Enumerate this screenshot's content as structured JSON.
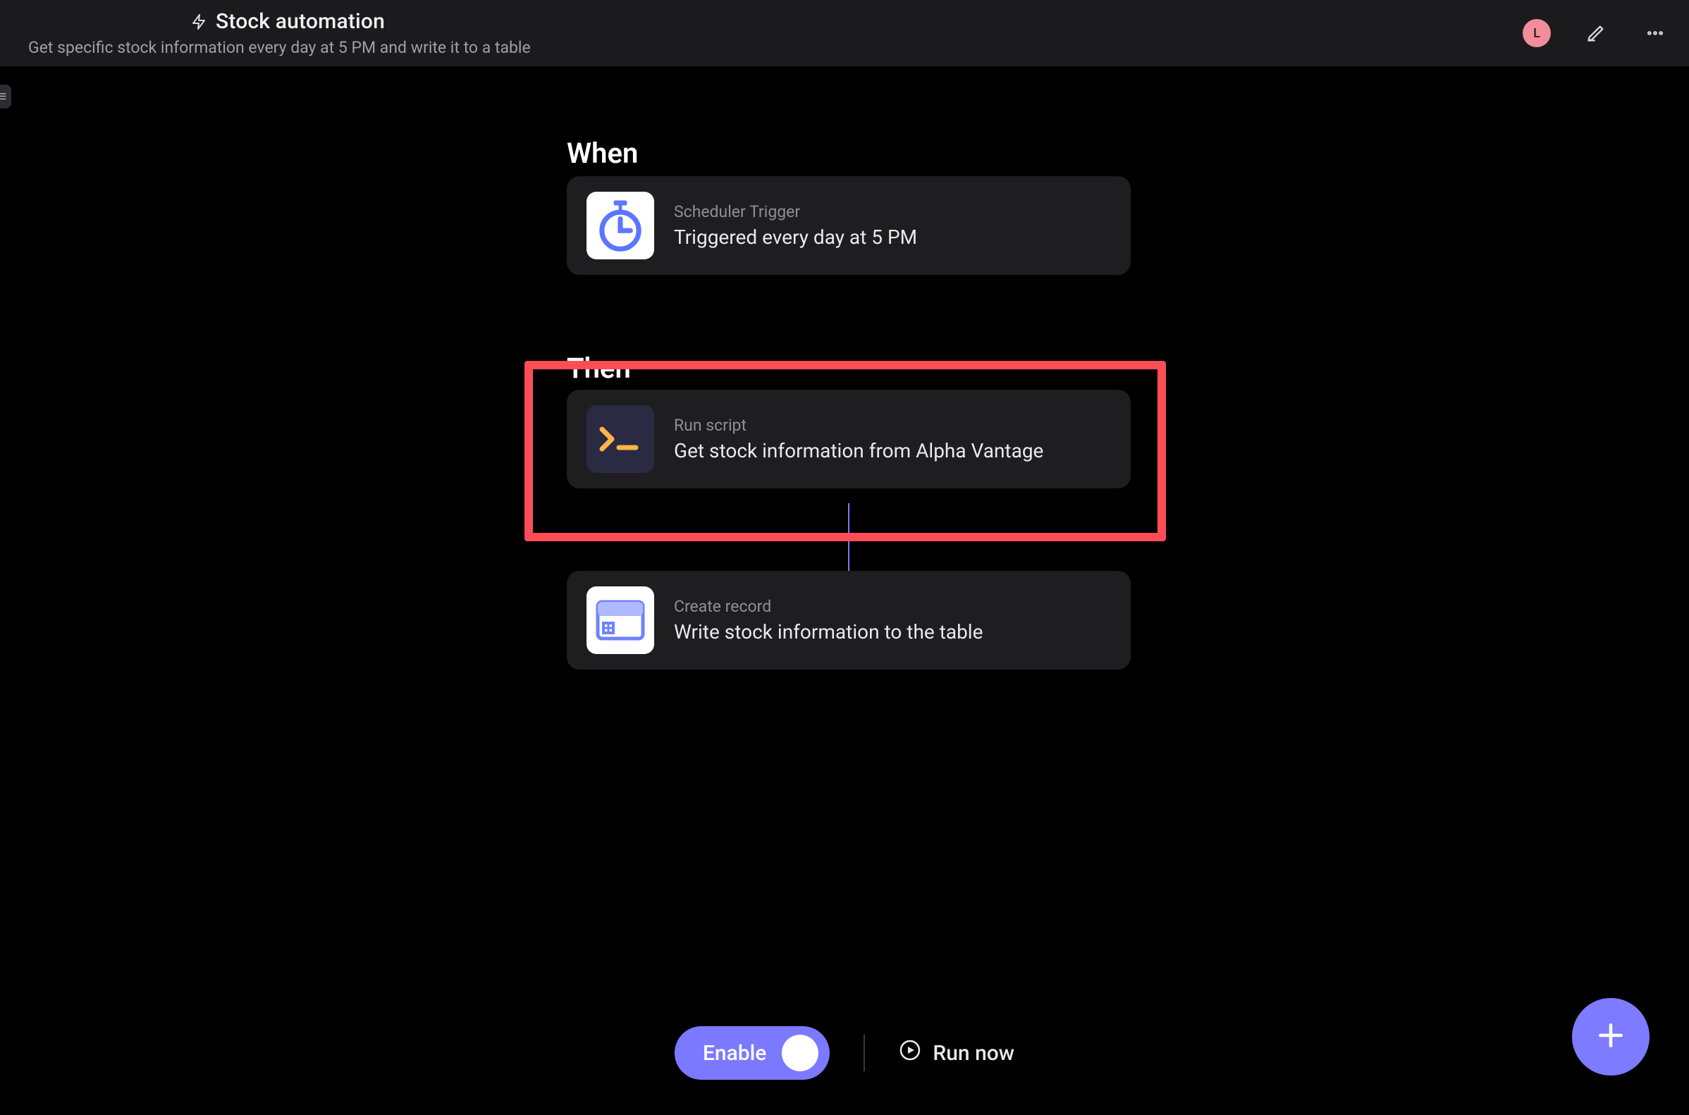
{
  "header": {
    "title": "Stock automation",
    "subtitle": "Get specific stock information every day at 5 PM and write it to a table",
    "avatar_initial": "L"
  },
  "sections": {
    "when_label": "When",
    "then_label": "Then"
  },
  "cards": {
    "trigger": {
      "kicker": "Scheduler Trigger",
      "title": "Triggered every day at 5 PM"
    },
    "script": {
      "kicker": "Run script",
      "title": "Get stock information from Alpha Vantage"
    },
    "record": {
      "kicker": "Create record",
      "title": "Write stock information to the table"
    }
  },
  "footer": {
    "enable_label": "Enable",
    "run_now_label": "Run now"
  },
  "annotation": {
    "highlight_target": "script-step"
  }
}
